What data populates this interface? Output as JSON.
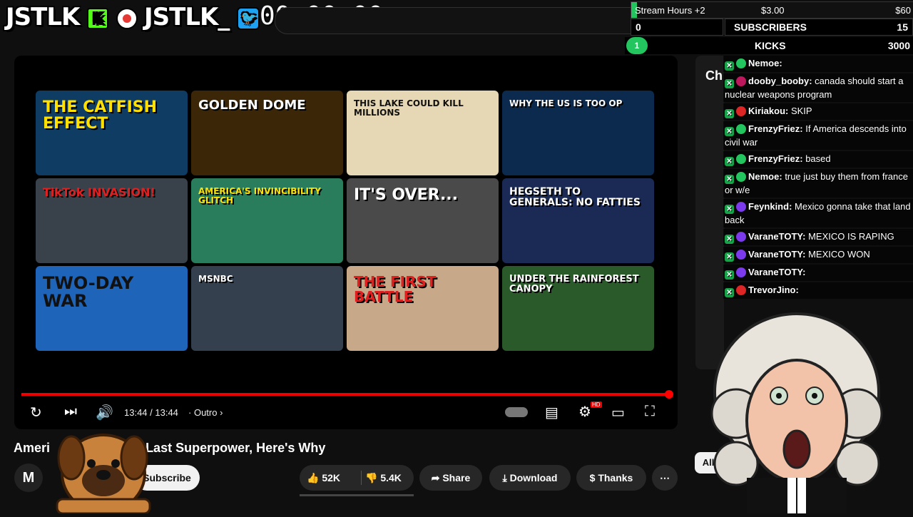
{
  "overlay": {
    "logo1": "JSTLK",
    "logo1_badge": "K",
    "logo2": "JSTLK_",
    "timer": "00:00:00"
  },
  "stream_stats": {
    "stream_hours": "Stream Hours +2",
    "price_mid": "$3.00",
    "price_right": "$60",
    "sub_count_left": "0",
    "subscribers_label": "SUBSCRIBERS",
    "subscribers_value": "15",
    "kicks_level": "1",
    "kicks_label": "KICKS",
    "kicks_value": "3000",
    "stream_hours_progress": 0.02
  },
  "thumbnails": [
    {
      "text": "THE CATFISH EFFECT",
      "bg": "#0e3c63"
    },
    {
      "text": "GOLDEN DOME",
      "bg": "#3b2608"
    },
    {
      "text": "THIS LAKE COULD KILL MILLIONS",
      "bg": "#e7d8b5"
    },
    {
      "text": "WHY THE US IS TOO OP",
      "bg": "#0c2a4d"
    },
    {
      "text": "TikTok INVASION!",
      "bg": "#39414a"
    },
    {
      "text": "AMERICA'S INVINCIBILITY GLITCH",
      "bg": "#2a7d5c"
    },
    {
      "text": "IT'S OVER...",
      "bg": "#4a4a4a"
    },
    {
      "text": "HEGSETH TO GENERALS: NO FATTIES",
      "bg": "#1a2a55"
    },
    {
      "text": "TWO-DAY WAR",
      "bg": "#1e64b8"
    },
    {
      "text": "MSNBC",
      "bg": "#35404e"
    },
    {
      "text": "THE FIRST BATTLE",
      "bg": "#c7a98a"
    },
    {
      "text": "UNDER THE RAINFOREST CANOPY",
      "bg": "#2a5a2a"
    }
  ],
  "player": {
    "time": "13:44 / 13:44",
    "chapter": "Outro",
    "progress": 1.0,
    "hd_badge": "HD"
  },
  "video": {
    "title_start": "Ameri",
    "title_end": "Last Superpower, Here's Why",
    "channel_logo": "M"
  },
  "actions": {
    "subscribe": "Subscribe",
    "likes": "52K",
    "dislikes": "5.4K",
    "share": "Share",
    "download": "Download",
    "thanks": "Thanks",
    "more": "⋯"
  },
  "side": {
    "chat_tab_partial": "Ch",
    "filter_all": "All"
  },
  "chat": [
    {
      "user": "Nemoe:",
      "msg": "",
      "color": "#22c55e"
    },
    {
      "user": "dooby_booby:",
      "msg": "canada should start a nuclear weapons program",
      "color": "#be185d"
    },
    {
      "user": "Kiriakou:",
      "msg": "SKIP",
      "color": "#dc2626"
    },
    {
      "user": "FrenzyFriez:",
      "msg": "If America descends into civil war",
      "color": "#22c55e"
    },
    {
      "user": "FrenzyFriez:",
      "msg": "based",
      "color": "#22c55e"
    },
    {
      "user": "Nemoe:",
      "msg": "true just buy them from france or w/e",
      "color": "#22c55e"
    },
    {
      "user": "Feynkind:",
      "msg": "Mexico gonna take that land back",
      "color": "#7c3aed"
    },
    {
      "user": "VaraneTOTY:",
      "msg": "MEXICO IS RAPING",
      "color": "#7c3aed"
    },
    {
      "user": "VaraneTOTY:",
      "msg": "MEXICO WON",
      "color": "#7c3aed"
    },
    {
      "user": "VaraneTOTY:",
      "msg": "",
      "color": "#7c3aed"
    },
    {
      "user": "TrevorJino:",
      "msg": "",
      "color": "#dc2626"
    }
  ]
}
